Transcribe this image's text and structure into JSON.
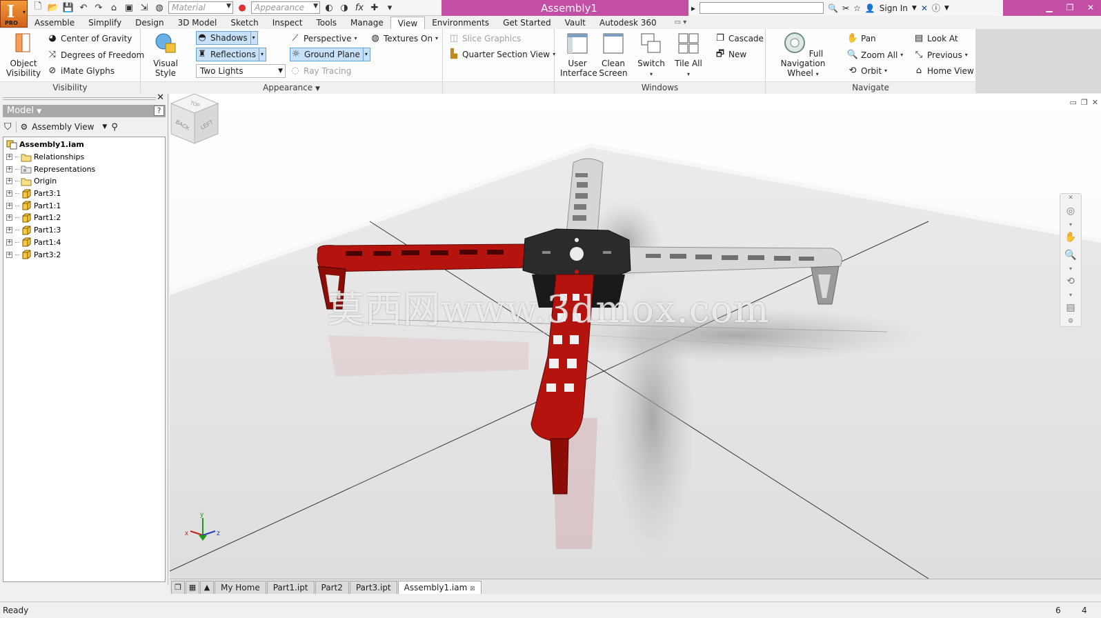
{
  "app": {
    "logo_letter": "I",
    "logo_badge": "PRO",
    "document_title": "Assembly1",
    "search_placeholder": "",
    "sign_in": "Sign In"
  },
  "quick_access": {
    "material_placeholder": "Material",
    "appearance_placeholder": "Appearance",
    "fx_label": "fx"
  },
  "tabs": [
    {
      "label": "Assemble"
    },
    {
      "label": "Simplify"
    },
    {
      "label": "Design"
    },
    {
      "label": "3D Model"
    },
    {
      "label": "Sketch"
    },
    {
      "label": "Inspect"
    },
    {
      "label": "Tools"
    },
    {
      "label": "Manage"
    },
    {
      "label": "View"
    },
    {
      "label": "Environments"
    },
    {
      "label": "Get Started"
    },
    {
      "label": "Vault"
    },
    {
      "label": "Autodesk 360"
    }
  ],
  "active_tab": "View",
  "ribbon": {
    "visibility": {
      "label": "Visibility",
      "object_visibility": "Object Visibility",
      "center_of_gravity": "Center of Gravity",
      "degrees_of_freedom": "Degrees of Freedom",
      "imate_glyphs": "iMate Glyphs"
    },
    "appearance": {
      "label": "Appearance",
      "visual_style": "Visual Style",
      "shadows": "Shadows",
      "reflections": "Reflections",
      "lighting": "Two Lights",
      "perspective": "Perspective",
      "ground_plane": "Ground Plane",
      "ray_tracing": "Ray Tracing",
      "textures_on": "Textures On",
      "slice_graphics": "Slice Graphics",
      "quarter_section_view": "Quarter Section View"
    },
    "windows": {
      "label": "Windows",
      "user_interface": "User Interface",
      "clean_screen": "Clean Screen",
      "switch": "Switch",
      "tile_all": "Tile All",
      "cascade": "Cascade",
      "new": "New"
    },
    "navigate": {
      "label": "Navigate",
      "full_navigation_wheel": "Full Navigation Wheel",
      "pan": "Pan",
      "zoom_all": "Zoom All",
      "orbit": "Orbit",
      "look_at": "Look At",
      "previous": "Previous",
      "home_view": "Home View"
    }
  },
  "browser": {
    "title": "Model",
    "view_mode": "Assembly View",
    "help": "?",
    "tree": [
      {
        "label": "Assembly1.iam",
        "icon": "assembly-icon"
      },
      {
        "label": "Relationships",
        "icon": "folder-icon"
      },
      {
        "label": "Representations",
        "icon": "representations-icon"
      },
      {
        "label": "Origin",
        "icon": "folder-icon"
      },
      {
        "label": "Part3:1",
        "icon": "part-icon"
      },
      {
        "label": "Part1:1",
        "icon": "part-icon"
      },
      {
        "label": "Part1:2",
        "icon": "part-icon"
      },
      {
        "label": "Part1:3",
        "icon": "part-icon"
      },
      {
        "label": "Part1:4",
        "icon": "part-icon"
      },
      {
        "label": "Part3:2",
        "icon": "part-icon"
      }
    ]
  },
  "viewport": {
    "watermark": "莫西网www.3dmox.com",
    "viewcube_faces": [
      "TOP",
      "BACK",
      "LEFT"
    ],
    "colors": {
      "arm_red": "#b5130e",
      "arm_white": "#d8d8d8",
      "center_plate": "#2b2b2b",
      "ground": "#e6e6e6"
    }
  },
  "doc_tabs": [
    {
      "label": "My Home"
    },
    {
      "label": "Part1.ipt"
    },
    {
      "label": "Part2"
    },
    {
      "label": "Part3.ipt"
    },
    {
      "label": "Assembly1.iam",
      "active": true
    }
  ],
  "status": {
    "text": "Ready",
    "count_a": "6",
    "count_b": "4"
  }
}
